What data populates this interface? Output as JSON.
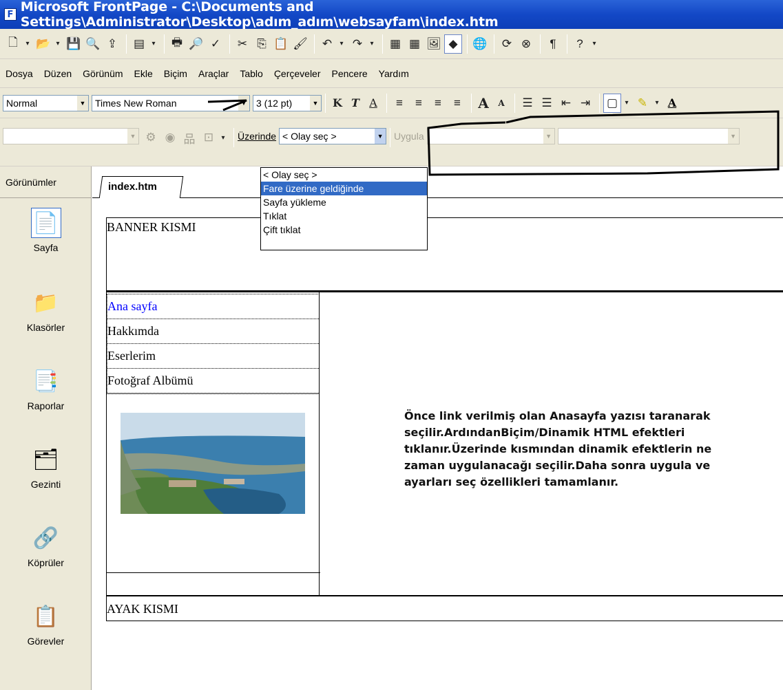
{
  "window": {
    "title": "Microsoft FrontPage - C:\\Documents and Settings\\Administrator\\Desktop\\adım_adım\\websayfam\\index.htm"
  },
  "menu": [
    "Dosya",
    "Düzen",
    "Görünüm",
    "Ekle",
    "Biçim",
    "Araçlar",
    "Tablo",
    "Çerçeveler",
    "Pencere",
    "Yardım"
  ],
  "formatting": {
    "style": "Normal",
    "font": "Times New Roman",
    "size": "3  (12 pt)"
  },
  "dhtml": {
    "on_label": "Üzerinde",
    "event_value": "< Olay seç >",
    "apply_label": "Uygula",
    "event_options": [
      "< Olay seç >",
      "Fare üzerine geldiğinde",
      "Sayfa yükleme",
      "Tıklat",
      "Çift tıklat"
    ],
    "highlighted_index": 1
  },
  "views": {
    "header": "Görünümler",
    "items": [
      "Sayfa",
      "Klasörler",
      "Raporlar",
      "Gezinti",
      "Köprüler",
      "Görevler"
    ]
  },
  "editor": {
    "tab": "index.htm",
    "banner": "BANNER KISMI",
    "nav_links": [
      "Ana sayfa",
      "Hakkımda",
      "Eserlerim",
      "Fotoğraf Albümü"
    ],
    "description": "Önce link verilmiş olan Anasayfa yazısı taranarak seçilir.ArdındanBiçim/Dinamik HTML efektleri tıklanır.Üzerinde kısmından dinamik efektlerin ne zaman uygulanacağı seçilir.Daha sonra uygula ve ayarları seç özellikleri tamamlanır.",
    "footer": "AYAK KISMI"
  },
  "colors": {
    "titlebar": "#1348c6",
    "highlight": "#316ac5",
    "link": "#0000ff",
    "chrome": "#ece9d8"
  }
}
